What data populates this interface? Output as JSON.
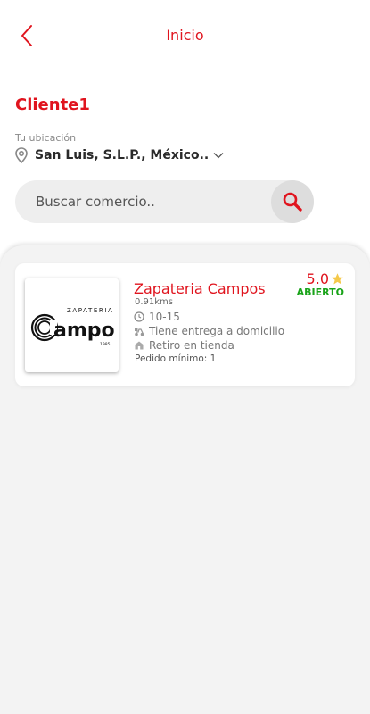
{
  "header": {
    "title": "Inicio"
  },
  "client": {
    "name": "Cliente1"
  },
  "location": {
    "label": "Tu ubicación",
    "value": "San Luis, S.L.P., México.."
  },
  "search": {
    "placeholder": "Buscar comercio.."
  },
  "stores": [
    {
      "name": "Zapateria Campos",
      "distance": "0.91kms",
      "delivery_time": "10-15",
      "delivery": "Tiene entrega a domicilio",
      "pickup": "Retiro en tienda",
      "min_order": "Pedido mínimo: 1",
      "rating": "5.0",
      "status": "ABIERTO",
      "logo": {
        "top_text": "ZAPATERIA",
        "main_text": "ampos",
        "initial": "C",
        "sub_text": "1985"
      }
    }
  ],
  "colors": {
    "accent": "#e0141e",
    "open": "#19a319",
    "star": "#f5c94a"
  }
}
